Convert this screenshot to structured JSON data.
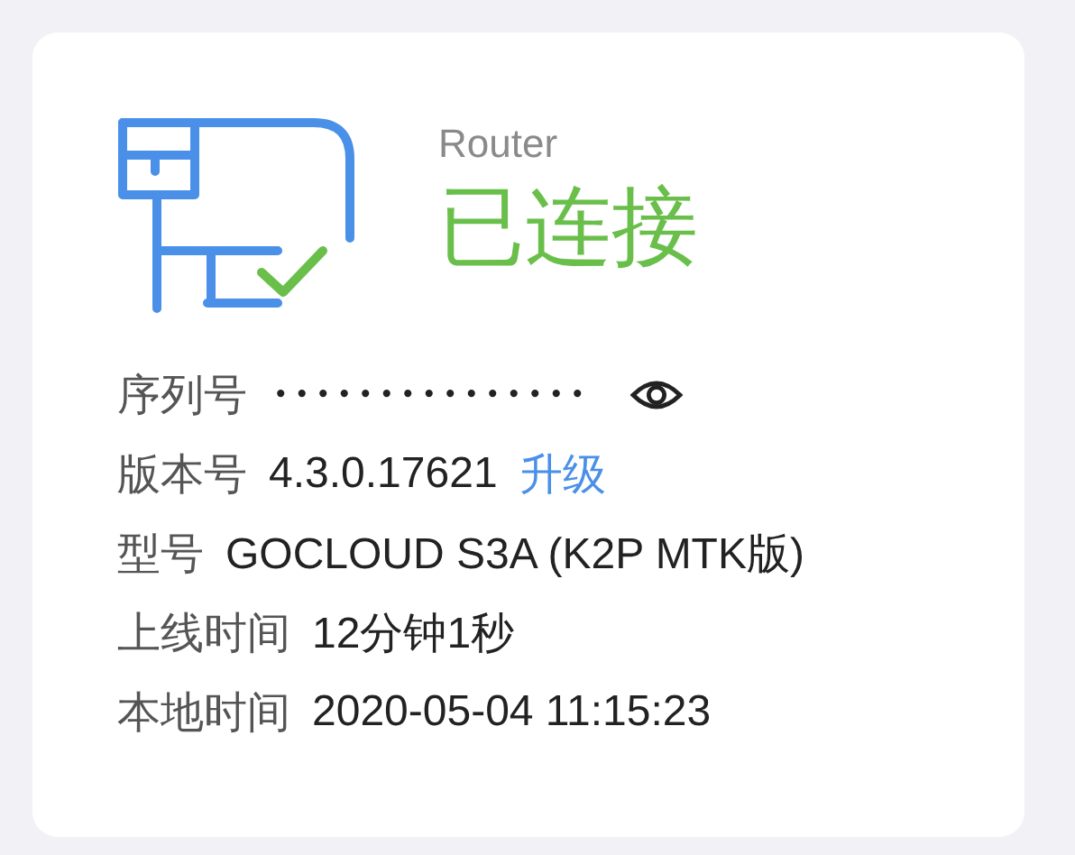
{
  "device": {
    "type": "Router",
    "status": "已连接",
    "connected": true
  },
  "details": [
    {
      "label": "序列号",
      "value": "•••••••••••••••",
      "kind": "masked"
    },
    {
      "label": "版本号",
      "value": "4.3.0.17621",
      "kind": "plain",
      "link": "升级"
    },
    {
      "label": "型号",
      "value": "GOCLOUD S3A (K2P MTK版)",
      "kind": "plain"
    },
    {
      "label": "上线时间",
      "value": "12分钟1秒",
      "kind": "plain"
    },
    {
      "label": "本地时间",
      "value": "2020-05-04 11:15:23",
      "kind": "plain"
    }
  ]
}
